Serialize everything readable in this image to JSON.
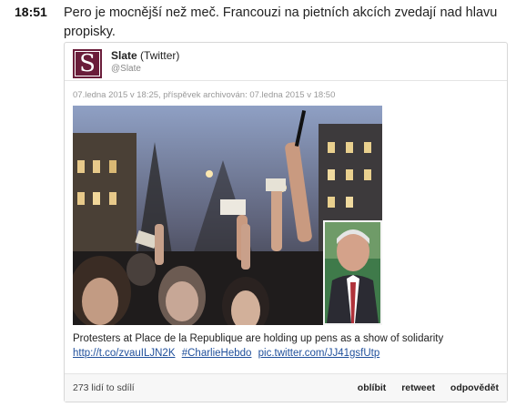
{
  "entry": {
    "time": "18:51",
    "headline": "Pero je mocnější než meč. Francouzi na pietních akcích zvedají nad hlavu propisky."
  },
  "tweet": {
    "avatar_letter": "S",
    "author_name": "Slate",
    "author_suffix": "(Twitter)",
    "handle": "@Slate",
    "meta": "07.ledna 2015 v 18:25, příspěvek archivován: 07.ledna 2015 v 18:50",
    "photo_alt": "Protesters holding up pens and press cards at night; inset portrait of a man in suit",
    "caption": "Protesters at Place de la Republique are holding up pens as a show of solidarity",
    "links": [
      "http://t.co/zvauILJN2K",
      "#CharlieHebdo",
      "pic.twitter.com/JJ41gsfUtp"
    ],
    "shares": "273 lidí to sdílí",
    "actions": {
      "like": "oblíbit",
      "retweet": "retweet",
      "reply": "odpovědět"
    }
  }
}
